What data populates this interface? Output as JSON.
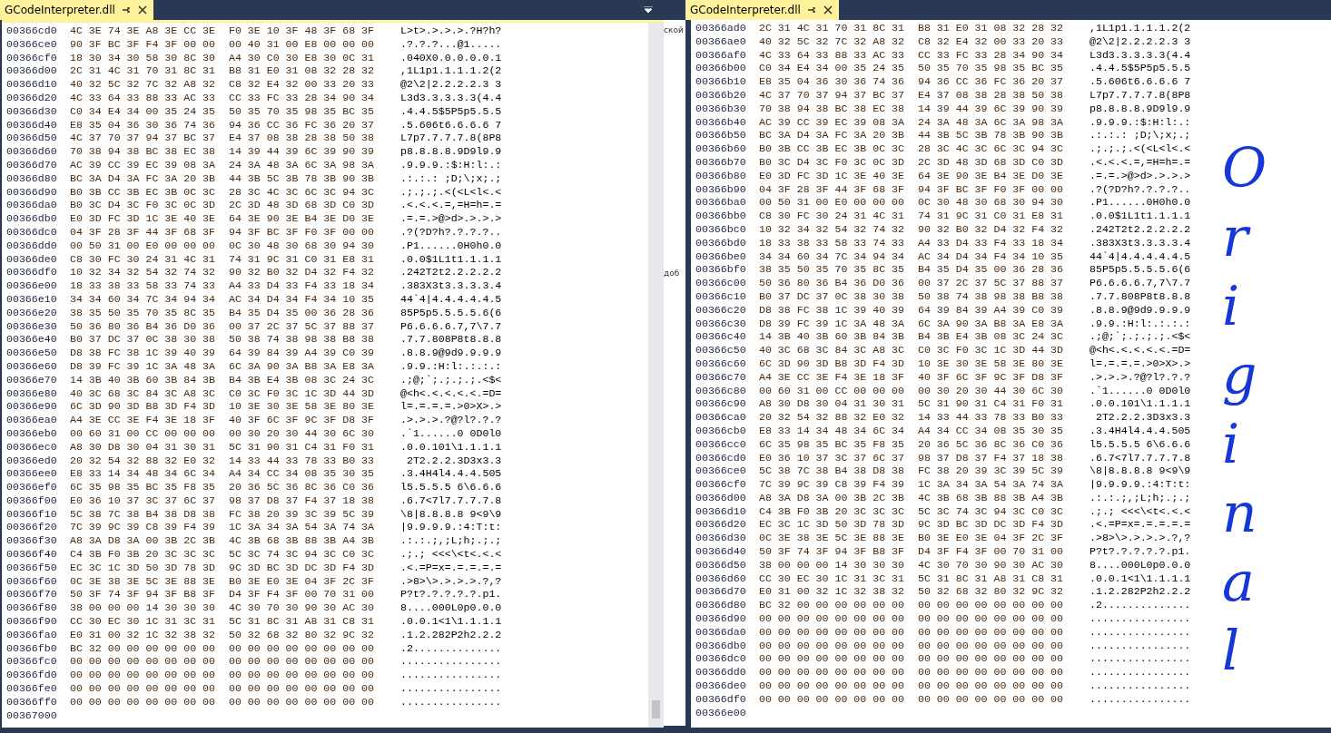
{
  "panes": [
    {
      "tab": {
        "title": "GCodeInterpreter.dll"
      },
      "rows": [
        {
          "address": "00366cd0",
          "hex_1": "4C 3E 74 3E A8 3E CC 3E",
          "hex_2": "F0 3E 10 3F 48 3F 68 3F",
          "ascii": "L>t>.>.>.>.?H?h?"
        },
        {
          "address": "00366ce0",
          "hex_1": "90 3F BC 3F F4 3F 00 00",
          "hex_2": "00 40 31 00 E8 00 00 00",
          "ascii": ".?.?.?...@1....."
        },
        {
          "address": "00366cf0",
          "hex_1": "18 30 34 30 58 30 8C 30",
          "hex_2": "A4 30 C0 30 E8 30 0C 31",
          "ascii": ".040X0.0.0.0.0.1"
        },
        {
          "address": "00366d00",
          "hex_1": "2C 31 4C 31 70 31 8C 31",
          "hex_2": "B8 31 E0 31 08 32 28 32",
          "ascii": ",1L1p1.1.1.1.2(2"
        },
        {
          "address": "00366d10",
          "hex_1": "40 32 5C 32 7C 32 A8 32",
          "hex_2": "C8 32 E4 32 00 33 20 33",
          "ascii": "@2\\2|2.2.2.2.3 3"
        },
        {
          "address": "00366d20",
          "hex_1": "4C 33 64 33 88 33 AC 33",
          "hex_2": "CC 33 FC 33 28 34 90 34",
          "ascii": "L3d3.3.3.3.3(4.4"
        },
        {
          "address": "00366d30",
          "hex_1": "C0 34 E4 34 00 35 24 35",
          "hex_2": "50 35 70 35 98 35 BC 35",
          "ascii": ".4.4.5$5P5p5.5.5"
        },
        {
          "address": "00366d40",
          "hex_1": "E8 35 04 36 30 36 74 36",
          "hex_2": "94 36 CC 36 FC 36 20 37",
          "ascii": ".5.606t6.6.6.6 7"
        },
        {
          "address": "00366d50",
          "hex_1": "4C 37 70 37 94 37 BC 37",
          "hex_2": "E4 37 08 38 28 38 50 38",
          "ascii": "L7p7.7.7.7.8(8P8"
        },
        {
          "address": "00366d60",
          "hex_1": "70 38 94 38 BC 38 EC 38",
          "hex_2": "14 39 44 39 6C 39 90 39",
          "ascii": "p8.8.8.8.9D9l9.9"
        },
        {
          "address": "00366d70",
          "hex_1": "AC 39 CC 39 EC 39 08 3A",
          "hex_2": "24 3A 48 3A 6C 3A 98 3A",
          "ascii": ".9.9.9.:$:H:l:.:"
        },
        {
          "address": "00366d80",
          "hex_1": "BC 3A D4 3A FC 3A 20 3B",
          "hex_2": "44 3B 5C 3B 78 3B 90 3B",
          "ascii": ".:.:.: ;D;\\;x;.;"
        },
        {
          "address": "00366d90",
          "hex_1": "B0 3B CC 3B EC 3B 0C 3C",
          "hex_2": "28 3C 4C 3C 6C 3C 94 3C",
          "ascii": ".;.;.;.<(<L<l<.<"
        },
        {
          "address": "00366da0",
          "hex_1": "B0 3C D4 3C F0 3C 0C 3D",
          "hex_2": "2C 3D 48 3D 68 3D C0 3D",
          "ascii": ".<.<.<.=,=H=h=.="
        },
        {
          "address": "00366db0",
          "hex_1": "E0 3D FC 3D 1C 3E 40 3E",
          "hex_2": "64 3E 90 3E B4 3E D0 3E",
          "ascii": ".=.=.>@>d>.>.>.>"
        },
        {
          "address": "00366dc0",
          "hex_1": "04 3F 28 3F 44 3F 68 3F",
          "hex_2": "94 3F BC 3F F0 3F 00 00",
          "ascii": ".?(?D?h?.?.?.?.."
        },
        {
          "address": "00366dd0",
          "hex_1": "00 50 31 00 E0 00 00 00",
          "hex_2": "0C 30 48 30 68 30 94 30",
          "ascii": ".P1......0H0h0.0"
        },
        {
          "address": "00366de0",
          "hex_1": "C8 30 FC 30 24 31 4C 31",
          "hex_2": "74 31 9C 31 C0 31 E8 31",
          "ascii": ".0.0$1L1t1.1.1.1"
        },
        {
          "address": "00366df0",
          "hex_1": "10 32 34 32 54 32 74 32",
          "hex_2": "90 32 B0 32 D4 32 F4 32",
          "ascii": ".242T2t2.2.2.2.2"
        },
        {
          "address": "00366e00",
          "hex_1": "18 33 38 33 58 33 74 33",
          "hex_2": "A4 33 D4 33 F4 33 18 34",
          "ascii": ".383X3t3.3.3.3.4"
        },
        {
          "address": "00366e10",
          "hex_1": "34 34 60 34 7C 34 94 34",
          "hex_2": "AC 34 D4 34 F4 34 10 35",
          "ascii": "44`4|4.4.4.4.4.5"
        },
        {
          "address": "00366e20",
          "hex_1": "38 35 50 35 70 35 8C 35",
          "hex_2": "B4 35 D4 35 00 36 28 36",
          "ascii": "85P5p5.5.5.5.6(6"
        },
        {
          "address": "00366e30",
          "hex_1": "50 36 80 36 B4 36 D0 36",
          "hex_2": "00 37 2C 37 5C 37 88 37",
          "ascii": "P6.6.6.6.7,7\\7.7"
        },
        {
          "address": "00366e40",
          "hex_1": "B0 37 DC 37 0C 38 30 38",
          "hex_2": "50 38 74 38 98 38 B8 38",
          "ascii": ".7.7.808P8t8.8.8"
        },
        {
          "address": "00366e50",
          "hex_1": "D8 38 FC 38 1C 39 40 39",
          "hex_2": "64 39 84 39 A4 39 C0 39",
          "ascii": ".8.8.9@9d9.9.9.9"
        },
        {
          "address": "00366e60",
          "hex_1": "D8 39 FC 39 1C 3A 48 3A",
          "hex_2": "6C 3A 90 3A B8 3A E8 3A",
          "ascii": ".9.9.:H:l:.:.:.:"
        },
        {
          "address": "00366e70",
          "hex_1": "14 3B 40 3B 60 3B 84 3B",
          "hex_2": "B4 3B E4 3B 08 3C 24 3C",
          "ascii": ".;@;`;.;.;.;.<$<"
        },
        {
          "address": "00366e80",
          "hex_1": "40 3C 68 3C 84 3C A8 3C",
          "hex_2": "C0 3C F0 3C 1C 3D 44 3D",
          "ascii": "@<h<.<.<.<.<.=D="
        },
        {
          "address": "00366e90",
          "hex_1": "6C 3D 90 3D B8 3D F4 3D",
          "hex_2": "10 3E 30 3E 58 3E 80 3E",
          "ascii": "l=.=.=.=.>0>X>.>"
        },
        {
          "address": "00366ea0",
          "hex_1": "A4 3E CC 3E F4 3E 18 3F",
          "hex_2": "40 3F 6C 3F 9C 3F D8 3F",
          "ascii": ".>.>.>.?@?l?.?.?"
        },
        {
          "address": "00366eb0",
          "hex_1": "00 60 31 00 CC 00 00 00",
          "hex_2": "00 30 20 30 44 30 6C 30",
          "ascii": ".`1......0 0D0l0"
        },
        {
          "address": "00366ec0",
          "hex_1": "A8 30 D8 30 04 31 30 31",
          "hex_2": "5C 31 90 31 C4 31 F0 31",
          "ascii": ".0.0.101\\1.1.1.1"
        },
        {
          "address": "00366ed0",
          "hex_1": "20 32 54 32 88 32 E0 32",
          "hex_2": "14 33 44 33 78 33 B0 33",
          "ascii": " 2T2.2.2.3D3x3.3"
        },
        {
          "address": "00366ee0",
          "hex_1": "E8 33 14 34 48 34 6C 34",
          "hex_2": "A4 34 CC 34 08 35 30 35",
          "ascii": ".3.4H4l4.4.4.505"
        },
        {
          "address": "00366ef0",
          "hex_1": "6C 35 98 35 BC 35 F8 35",
          "hex_2": "20 36 5C 36 8C 36 C0 36",
          "ascii": "l5.5.5.5 6\\6.6.6"
        },
        {
          "address": "00366f00",
          "hex_1": "E0 36 10 37 3C 37 6C 37",
          "hex_2": "98 37 D8 37 F4 37 18 38",
          "ascii": ".6.7<7l7.7.7.7.8"
        },
        {
          "address": "00366f10",
          "hex_1": "5C 38 7C 38 B4 38 D8 38",
          "hex_2": "FC 38 20 39 3C 39 5C 39",
          "ascii": "\\8|8.8.8.8 9<9\\9"
        },
        {
          "address": "00366f20",
          "hex_1": "7C 39 9C 39 C8 39 F4 39",
          "hex_2": "1C 3A 34 3A 54 3A 74 3A",
          "ascii": "|9.9.9.9.:4:T:t:"
        },
        {
          "address": "00366f30",
          "hex_1": "A8 3A D8 3A 00 3B 2C 3B",
          "hex_2": "4C 3B 68 3B 88 3B A4 3B",
          "ascii": ".:.:.;,;L;h;.;.;"
        },
        {
          "address": "00366f40",
          "hex_1": "C4 3B F0 3B 20 3C 3C 3C",
          "hex_2": "5C 3C 74 3C 94 3C C0 3C",
          "ascii": ".;.; <<<\\<t<.<.<"
        },
        {
          "address": "00366f50",
          "hex_1": "EC 3C 1C 3D 50 3D 78 3D",
          "hex_2": "9C 3D BC 3D DC 3D F4 3D",
          "ascii": ".<.=P=x=.=.=.=.="
        },
        {
          "address": "00366f60",
          "hex_1": "0C 3E 38 3E 5C 3E 88 3E",
          "hex_2": "B0 3E E0 3E 04 3F 2C 3F",
          "ascii": ".>8>\\>.>.>.>.?,?"
        },
        {
          "address": "00366f70",
          "hex_1": "50 3F 74 3F 94 3F B8 3F",
          "hex_2": "D4 3F F4 3F 00 70 31 00",
          "ascii": "P?t?.?.?.?.?.p1."
        },
        {
          "address": "00366f80",
          "hex_1": "38 00 00 00 14 30 30 30",
          "hex_2": "4C 30 70 30 90 30 AC 30",
          "ascii": "8....000L0p0.0.0"
        },
        {
          "address": "00366f90",
          "hex_1": "CC 30 EC 30 1C 31 3C 31",
          "hex_2": "5C 31 8C 31 A8 31 C8 31",
          "ascii": ".0.0.1<1\\1.1.1.1"
        },
        {
          "address": "00366fa0",
          "hex_1": "E0 31 00 32 1C 32 38 32",
          "hex_2": "50 32 68 32 80 32 9C 32",
          "ascii": ".1.2.282P2h2.2.2"
        },
        {
          "address": "00366fb0",
          "hex_1": "BC 32 00 00 00 00 00 00",
          "hex_2": "00 00 00 00 00 00 00 00",
          "ascii": ".2.............."
        },
        {
          "address": "00366fc0",
          "hex_1": "00 00 00 00 00 00 00 00",
          "hex_2": "00 00 00 00 00 00 00 00",
          "ascii": "................"
        },
        {
          "address": "00366fd0",
          "hex_1": "00 00 00 00 00 00 00 00",
          "hex_2": "00 00 00 00 00 00 00 00",
          "ascii": "................"
        },
        {
          "address": "00366fe0",
          "hex_1": "00 00 00 00 00 00 00 00",
          "hex_2": "00 00 00 00 00 00 00 00",
          "ascii": "................"
        },
        {
          "address": "00366ff0",
          "hex_1": "00 00 00 00 00 00 00 00",
          "hex_2": "00 00 00 00 00 00 00 00",
          "ascii": "................"
        },
        {
          "address": "00367000"
        }
      ]
    },
    {
      "tab": {
        "title": "GCodeInterpreter.dll"
      },
      "rows": [
        {
          "address": "00366ad0",
          "hex_1": "2C 31 4C 31 70 31 8C 31",
          "hex_2": "B8 31 E0 31 08 32 28 32",
          "ascii": ",1L1p1.1.1.1.2(2"
        },
        {
          "address": "00366ae0",
          "hex_1": "40 32 5C 32 7C 32 A8 32",
          "hex_2": "C8 32 E4 32 00 33 20 33",
          "ascii": "@2\\2|2.2.2.2.3 3"
        },
        {
          "address": "00366af0",
          "hex_1": "4C 33 64 33 88 33 AC 33",
          "hex_2": "CC 33 FC 33 28 34 90 34",
          "ascii": "L3d3.3.3.3.3(4.4"
        },
        {
          "address": "00366b00",
          "hex_1": "C0 34 E4 34 00 35 24 35",
          "hex_2": "50 35 70 35 98 35 BC 35",
          "ascii": ".4.4.5$5P5p5.5.5"
        },
        {
          "address": "00366b10",
          "hex_1": "E8 35 04 36 30 36 74 36",
          "hex_2": "94 36 CC 36 FC 36 20 37",
          "ascii": ".5.606t6.6.6.6 7"
        },
        {
          "address": "00366b20",
          "hex_1": "4C 37 70 37 94 37 BC 37",
          "hex_2": "E4 37 08 38 28 38 50 38",
          "ascii": "L7p7.7.7.7.8(8P8"
        },
        {
          "address": "00366b30",
          "hex_1": "70 38 94 38 BC 38 EC 38",
          "hex_2": "14 39 44 39 6C 39 90 39",
          "ascii": "p8.8.8.8.9D9l9.9"
        },
        {
          "address": "00366b40",
          "hex_1": "AC 39 CC 39 EC 39 08 3A",
          "hex_2": "24 3A 48 3A 6C 3A 98 3A",
          "ascii": ".9.9.9.:$:H:l:.:"
        },
        {
          "address": "00366b50",
          "hex_1": "BC 3A D4 3A FC 3A 20 3B",
          "hex_2": "44 3B 5C 3B 78 3B 90 3B",
          "ascii": ".:.:.: ;D;\\;x;.;"
        },
        {
          "address": "00366b60",
          "hex_1": "B0 3B CC 3B EC 3B 0C 3C",
          "hex_2": "28 3C 4C 3C 6C 3C 94 3C",
          "ascii": ".;.;.;.<(<L<l<.<"
        },
        {
          "address": "00366b70",
          "hex_1": "B0 3C D4 3C F0 3C 0C 3D",
          "hex_2": "2C 3D 48 3D 68 3D C0 3D",
          "ascii": ".<.<.<.=,=H=h=.="
        },
        {
          "address": "00366b80",
          "hex_1": "E0 3D FC 3D 1C 3E 40 3E",
          "hex_2": "64 3E 90 3E B4 3E D0 3E",
          "ascii": ".=.=.>@>d>.>.>.>"
        },
        {
          "address": "00366b90",
          "hex_1": "04 3F 28 3F 44 3F 68 3F",
          "hex_2": "94 3F BC 3F F0 3F 00 00",
          "ascii": ".?(?D?h?.?.?.?.."
        },
        {
          "address": "00366ba0",
          "hex_1": "00 50 31 00 E0 00 00 00",
          "hex_2": "0C 30 48 30 68 30 94 30",
          "ascii": ".P1......0H0h0.0"
        },
        {
          "address": "00366bb0",
          "hex_1": "C8 30 FC 30 24 31 4C 31",
          "hex_2": "74 31 9C 31 C0 31 E8 31",
          "ascii": ".0.0$1L1t1.1.1.1"
        },
        {
          "address": "00366bc0",
          "hex_1": "10 32 34 32 54 32 74 32",
          "hex_2": "90 32 B0 32 D4 32 F4 32",
          "ascii": ".242T2t2.2.2.2.2"
        },
        {
          "address": "00366bd0",
          "hex_1": "18 33 38 33 58 33 74 33",
          "hex_2": "A4 33 D4 33 F4 33 18 34",
          "ascii": ".383X3t3.3.3.3.4"
        },
        {
          "address": "00366be0",
          "hex_1": "34 34 60 34 7C 34 94 34",
          "hex_2": "AC 34 D4 34 F4 34 10 35",
          "ascii": "44`4|4.4.4.4.4.5"
        },
        {
          "address": "00366bf0",
          "hex_1": "38 35 50 35 70 35 8C 35",
          "hex_2": "B4 35 D4 35 00 36 28 36",
          "ascii": "85P5p5.5.5.5.6(6"
        },
        {
          "address": "00366c00",
          "hex_1": "50 36 80 36 B4 36 D0 36",
          "hex_2": "00 37 2C 37 5C 37 88 37",
          "ascii": "P6.6.6.6.7,7\\7.7"
        },
        {
          "address": "00366c10",
          "hex_1": "B0 37 DC 37 0C 38 30 38",
          "hex_2": "50 38 74 38 98 38 B8 38",
          "ascii": ".7.7.808P8t8.8.8"
        },
        {
          "address": "00366c20",
          "hex_1": "D8 38 FC 38 1C 39 40 39",
          "hex_2": "64 39 84 39 A4 39 C0 39",
          "ascii": ".8.8.9@9d9.9.9.9"
        },
        {
          "address": "00366c30",
          "hex_1": "D8 39 FC 39 1C 3A 48 3A",
          "hex_2": "6C 3A 90 3A B8 3A E8 3A",
          "ascii": ".9.9.:H:l:.:.:.:"
        },
        {
          "address": "00366c40",
          "hex_1": "14 3B 40 3B 60 3B 84 3B",
          "hex_2": "B4 3B E4 3B 08 3C 24 3C",
          "ascii": ".;@;`;.;.;.;.<$<"
        },
        {
          "address": "00366c50",
          "hex_1": "40 3C 68 3C 84 3C A8 3C",
          "hex_2": "C0 3C F0 3C 1C 3D 44 3D",
          "ascii": "@<h<.<.<.<.<.=D="
        },
        {
          "address": "00366c60",
          "hex_1": "6C 3D 90 3D B8 3D F4 3D",
          "hex_2": "10 3E 30 3E 58 3E 80 3E",
          "ascii": "l=.=.=.=.>0>X>.>"
        },
        {
          "address": "00366c70",
          "hex_1": "A4 3E CC 3E F4 3E 18 3F",
          "hex_2": "40 3F 6C 3F 9C 3F D8 3F",
          "ascii": ".>.>.>.?@?l?.?.?"
        },
        {
          "address": "00366c80",
          "hex_1": "00 60 31 00 CC 00 00 00",
          "hex_2": "00 30 20 30 44 30 6C 30",
          "ascii": ".`1......0 0D0l0"
        },
        {
          "address": "00366c90",
          "hex_1": "A8 30 D8 30 04 31 30 31",
          "hex_2": "5C 31 90 31 C4 31 F0 31",
          "ascii": ".0.0.101\\1.1.1.1"
        },
        {
          "address": "00366ca0",
          "hex_1": "20 32 54 32 88 32 E0 32",
          "hex_2": "14 33 44 33 78 33 B0 33",
          "ascii": " 2T2.2.2.3D3x3.3"
        },
        {
          "address": "00366cb0",
          "hex_1": "E8 33 14 34 48 34 6C 34",
          "hex_2": "A4 34 CC 34 08 35 30 35",
          "ascii": ".3.4H4l4.4.4.505"
        },
        {
          "address": "00366cc0",
          "hex_1": "6C 35 98 35 BC 35 F8 35",
          "hex_2": "20 36 5C 36 8C 36 C0 36",
          "ascii": "l5.5.5.5 6\\6.6.6"
        },
        {
          "address": "00366cd0",
          "hex_1": "E0 36 10 37 3C 37 6C 37",
          "hex_2": "98 37 D8 37 F4 37 18 38",
          "ascii": ".6.7<7l7.7.7.7.8"
        },
        {
          "address": "00366ce0",
          "hex_1": "5C 38 7C 38 B4 38 D8 38",
          "hex_2": "FC 38 20 39 3C 39 5C 39",
          "ascii": "\\8|8.8.8.8 9<9\\9"
        },
        {
          "address": "00366cf0",
          "hex_1": "7C 39 9C 39 C8 39 F4 39",
          "hex_2": "1C 3A 34 3A 54 3A 74 3A",
          "ascii": "|9.9.9.9.:4:T:t:"
        },
        {
          "address": "00366d00",
          "hex_1": "A8 3A D8 3A 00 3B 2C 3B",
          "hex_2": "4C 3B 68 3B 88 3B A4 3B",
          "ascii": ".:.:.;,;L;h;.;.;"
        },
        {
          "address": "00366d10",
          "hex_1": "C4 3B F0 3B 20 3C 3C 3C",
          "hex_2": "5C 3C 74 3C 94 3C C0 3C",
          "ascii": ".;.; <<<\\<t<.<.<"
        },
        {
          "address": "00366d20",
          "hex_1": "EC 3C 1C 3D 50 3D 78 3D",
          "hex_2": "9C 3D BC 3D DC 3D F4 3D",
          "ascii": ".<.=P=x=.=.=.=.="
        },
        {
          "address": "00366d30",
          "hex_1": "0C 3E 38 3E 5C 3E 88 3E",
          "hex_2": "B0 3E E0 3E 04 3F 2C 3F",
          "ascii": ".>8>\\>.>.>.>.?,?"
        },
        {
          "address": "00366d40",
          "hex_1": "50 3F 74 3F 94 3F B8 3F",
          "hex_2": "D4 3F F4 3F 00 70 31 00",
          "ascii": "P?t?.?.?.?.?.p1."
        },
        {
          "address": "00366d50",
          "hex_1": "38 00 00 00 14 30 30 30",
          "hex_2": "4C 30 70 30 90 30 AC 30",
          "ascii": "8....000L0p0.0.0"
        },
        {
          "address": "00366d60",
          "hex_1": "CC 30 EC 30 1C 31 3C 31",
          "hex_2": "5C 31 8C 31 A8 31 C8 31",
          "ascii": ".0.0.1<1\\1.1.1.1"
        },
        {
          "address": "00366d70",
          "hex_1": "E0 31 00 32 1C 32 38 32",
          "hex_2": "50 32 68 32 80 32 9C 32",
          "ascii": ".1.2.282P2h2.2.2"
        },
        {
          "address": "00366d80",
          "hex_1": "BC 32 00 00 00 00 00 00",
          "hex_2": "00 00 00 00 00 00 00 00",
          "ascii": ".2.............."
        },
        {
          "address": "00366d90",
          "hex_1": "00 00 00 00 00 00 00 00",
          "hex_2": "00 00 00 00 00 00 00 00",
          "ascii": "................"
        },
        {
          "address": "00366da0",
          "hex_1": "00 00 00 00 00 00 00 00",
          "hex_2": "00 00 00 00 00 00 00 00",
          "ascii": "................"
        },
        {
          "address": "00366db0",
          "hex_1": "00 00 00 00 00 00 00 00",
          "hex_2": "00 00 00 00 00 00 00 00",
          "ascii": "................"
        },
        {
          "address": "00366dc0",
          "hex_1": "00 00 00 00 00 00 00 00",
          "hex_2": "00 00 00 00 00 00 00 00",
          "ascii": "................"
        },
        {
          "address": "00366dd0",
          "hex_1": "00 00 00 00 00 00 00 00",
          "hex_2": "00 00 00 00 00 00 00 00",
          "ascii": "................"
        },
        {
          "address": "00366de0",
          "hex_1": "00 00 00 00 00 00 00 00",
          "hex_2": "00 00 00 00 00 00 00 00",
          "ascii": "................"
        },
        {
          "address": "00366df0",
          "hex_1": "00 00 00 00 00 00 00 00",
          "hex_2": "00 00 00 00 00 00 00 00",
          "ascii": "................"
        },
        {
          "address": "00366e00"
        }
      ],
      "handwritten_note": "Original"
    }
  ],
  "background_window": {
    "texts": [
      "ской",
      "доб"
    ]
  }
}
